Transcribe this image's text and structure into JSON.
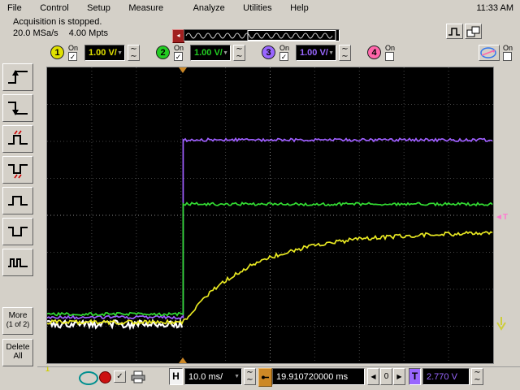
{
  "menu_bar": {
    "items": [
      "File",
      "Control",
      "Setup",
      "Measure",
      "Analyze",
      "Utilities",
      "Help"
    ],
    "clock": "11:33 AM"
  },
  "status": {
    "line1": "Acquisition is stopped.",
    "sample_rate": "20.0 MSa/s",
    "memory_depth": "4.00 Mpts"
  },
  "channels": [
    {
      "number": "1",
      "on_label": "On",
      "check": "✓",
      "scale": "1.00 V/",
      "color": "#e0e000"
    },
    {
      "number": "2",
      "on_label": "On",
      "check": "✓",
      "scale": "1.00 V/",
      "color": "#22cc22"
    },
    {
      "number": "3",
      "on_label": "On",
      "check": "✓",
      "scale": "1.00 V/",
      "color": "#9966ff"
    },
    {
      "number": "4",
      "on_label": "On",
      "check": "",
      "color": "#ff66aa"
    }
  ],
  "aux_display": {
    "on_label": "On",
    "check": ""
  },
  "left_toolbar": {
    "icons": [
      "rising-edge",
      "falling-edge",
      "glitch-positive",
      "glitch-negative",
      "pulse-positive",
      "pulse-negative",
      "pulse-burst"
    ],
    "more_label_1": "More",
    "more_label_2": "(1 of 2)",
    "delete_label_1": "Delete",
    "delete_label_2": "All"
  },
  "plot": {
    "ch1_marker": "1"
  },
  "horizontal": {
    "h_label": "H",
    "timebase": "10.0 ms/",
    "delay": "19.910720000 ms",
    "position_left": "◀",
    "position_value": "0",
    "position_right": "▶"
  },
  "trigger": {
    "t_label": "T",
    "level": "2.770 V",
    "marker": "◄T"
  },
  "markers": {
    "trigger_color": "#cc8826",
    "t_marker_color": "#ff79d0",
    "arrow_color": "#cdcd3a"
  },
  "chart_data": {
    "type": "line",
    "title": "Oscilloscope graticule 10 x 8 divisions",
    "x_axis": {
      "scale_per_div": "10.0 ms/div",
      "divisions": 10,
      "delay_reference": "19.910720000 ms"
    },
    "y_axis": {
      "scale_per_div": "1.00 V/div",
      "divisions": 8
    },
    "trigger": {
      "source": "channel-3",
      "level": "2.770 V",
      "time_frac": 0.305
    },
    "step_frac": 0.305,
    "series": [
      {
        "name": "channel-3",
        "color": "#9f5fff",
        "kind": "step",
        "base": 0.845,
        "high": 0.245,
        "noise": 0.005,
        "width": 1.7
      },
      {
        "name": "channel-2",
        "color": "#33dd33",
        "kind": "step",
        "base": 0.834,
        "high": 0.462,
        "noise": 0.005,
        "width": 1.7
      },
      {
        "name": "channel-1-baseline-bloom",
        "color": "#ffffff",
        "kind": "flat-left",
        "base": 0.868,
        "noise": 0.013,
        "width": 2.2
      },
      {
        "name": "channel-1",
        "color": "#e8e822",
        "kind": "exp",
        "base": 0.861,
        "high": 0.557,
        "tau": 0.155,
        "noise": 0.007,
        "width": 1.7
      }
    ]
  }
}
